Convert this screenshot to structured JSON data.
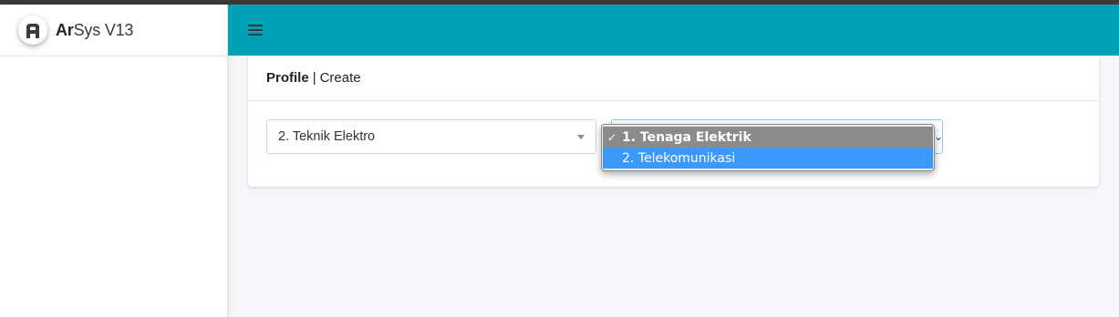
{
  "brand": {
    "logo_letter": "A",
    "name_bold": "Ar",
    "name_rest": "Sys V13"
  },
  "navbar": {
    "menu_icon": "hamburger-icon",
    "color": "#00a0b6"
  },
  "card": {
    "breadcrumb_strong": "Profile",
    "breadcrumb_sep": "|",
    "breadcrumb_page": "Create"
  },
  "form": {
    "program_select": {
      "value": "2. Teknik Elektro"
    },
    "specialization_select": {
      "options": [
        {
          "label": "1. Tenaga Elektrik",
          "selected": true
        },
        {
          "label": "2. Telekomunikasi",
          "selected": false
        }
      ],
      "check_glyph": "✓"
    }
  }
}
